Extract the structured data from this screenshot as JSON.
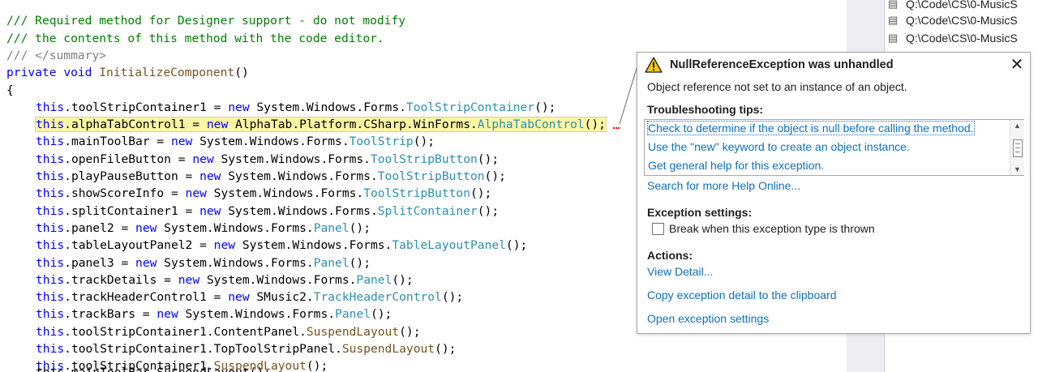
{
  "editor": {
    "lines": [
      [
        {
          "t": "/// ",
          "c": "comment"
        },
        {
          "t": "Required method for Designer support - do not modify",
          "c": "comment"
        }
      ],
      [
        {
          "t": "/// ",
          "c": "comment"
        },
        {
          "t": "the contents of this method with the code editor.",
          "c": "comment"
        }
      ],
      [
        {
          "t": "/// ",
          "c": "doctag"
        },
        {
          "t": "</summary>",
          "c": "doctag"
        }
      ],
      [
        {
          "t": "private",
          "c": "kw"
        },
        {
          "t": " ",
          "c": ""
        },
        {
          "t": "void",
          "c": "kw"
        },
        {
          "t": " ",
          "c": ""
        },
        {
          "t": "InitializeComponent",
          "c": "method"
        },
        {
          "t": "()",
          "c": ""
        }
      ],
      [
        {
          "t": "{",
          "c": ""
        }
      ],
      [
        {
          "t": "this",
          "c": "kw"
        },
        {
          "t": ".toolStripContainer1 = ",
          "c": ""
        },
        {
          "t": "new",
          "c": "kw"
        },
        {
          "t": " System.Windows.Forms.",
          "c": ""
        },
        {
          "t": "ToolStripContainer",
          "c": "type"
        },
        {
          "t": "();",
          "c": ""
        }
      ],
      [
        {
          "t": "this",
          "c": "kw"
        },
        {
          "t": ".alphaTabControl1 = ",
          "c": ""
        },
        {
          "t": "new",
          "c": "kw"
        },
        {
          "t": " AlphaTab.Platform.CSharp.WinForms.",
          "c": ""
        },
        {
          "t": "AlphaTabControl",
          "c": "type"
        },
        {
          "t": "();",
          "c": ""
        }
      ],
      [
        {
          "t": "this",
          "c": "kw"
        },
        {
          "t": ".mainToolBar = ",
          "c": ""
        },
        {
          "t": "new",
          "c": "kw"
        },
        {
          "t": " System.Windows.Forms.",
          "c": ""
        },
        {
          "t": "ToolStrip",
          "c": "type"
        },
        {
          "t": "();",
          "c": ""
        }
      ],
      [
        {
          "t": "this",
          "c": "kw"
        },
        {
          "t": ".openFileButton = ",
          "c": ""
        },
        {
          "t": "new",
          "c": "kw"
        },
        {
          "t": " System.Windows.Forms.",
          "c": ""
        },
        {
          "t": "ToolStripButton",
          "c": "type"
        },
        {
          "t": "();",
          "c": ""
        }
      ],
      [
        {
          "t": "this",
          "c": "kw"
        },
        {
          "t": ".playPauseButton = ",
          "c": ""
        },
        {
          "t": "new",
          "c": "kw"
        },
        {
          "t": " System.Windows.Forms.",
          "c": ""
        },
        {
          "t": "ToolStripButton",
          "c": "type"
        },
        {
          "t": "();",
          "c": ""
        }
      ],
      [
        {
          "t": "this",
          "c": "kw"
        },
        {
          "t": ".showScoreInfo = ",
          "c": ""
        },
        {
          "t": "new",
          "c": "kw"
        },
        {
          "t": " System.Windows.Forms.",
          "c": ""
        },
        {
          "t": "ToolStripButton",
          "c": "type"
        },
        {
          "t": "();",
          "c": ""
        }
      ],
      [
        {
          "t": "this",
          "c": "kw"
        },
        {
          "t": ".splitContainer1 = ",
          "c": ""
        },
        {
          "t": "new",
          "c": "kw"
        },
        {
          "t": " System.Windows.Forms.",
          "c": ""
        },
        {
          "t": "SplitContainer",
          "c": "type"
        },
        {
          "t": "();",
          "c": ""
        }
      ],
      [
        {
          "t": "this",
          "c": "kw"
        },
        {
          "t": ".panel2 = ",
          "c": ""
        },
        {
          "t": "new",
          "c": "kw"
        },
        {
          "t": " System.Windows.Forms.",
          "c": ""
        },
        {
          "t": "Panel",
          "c": "type"
        },
        {
          "t": "();",
          "c": ""
        }
      ],
      [
        {
          "t": "this",
          "c": "kw"
        },
        {
          "t": ".tableLayoutPanel2 = ",
          "c": ""
        },
        {
          "t": "new",
          "c": "kw"
        },
        {
          "t": " System.Windows.Forms.",
          "c": ""
        },
        {
          "t": "TableLayoutPanel",
          "c": "type"
        },
        {
          "t": "();",
          "c": ""
        }
      ],
      [
        {
          "t": "this",
          "c": "kw"
        },
        {
          "t": ".panel3 = ",
          "c": ""
        },
        {
          "t": "new",
          "c": "kw"
        },
        {
          "t": " System.Windows.Forms.",
          "c": ""
        },
        {
          "t": "Panel",
          "c": "type"
        },
        {
          "t": "();",
          "c": ""
        }
      ],
      [
        {
          "t": "this",
          "c": "kw"
        },
        {
          "t": ".trackDetails = ",
          "c": ""
        },
        {
          "t": "new",
          "c": "kw"
        },
        {
          "t": " System.Windows.Forms.",
          "c": ""
        },
        {
          "t": "Panel",
          "c": "type"
        },
        {
          "t": "();",
          "c": ""
        }
      ],
      [
        {
          "t": "this",
          "c": "kw"
        },
        {
          "t": ".trackHeaderControl1 = ",
          "c": ""
        },
        {
          "t": "new",
          "c": "kw"
        },
        {
          "t": " SMusic2.",
          "c": ""
        },
        {
          "t": "TrackHeaderControl",
          "c": "type"
        },
        {
          "t": "();",
          "c": ""
        }
      ],
      [
        {
          "t": "this",
          "c": "kw"
        },
        {
          "t": ".trackBars = ",
          "c": ""
        },
        {
          "t": "new",
          "c": "kw"
        },
        {
          "t": " System.Windows.Forms.",
          "c": ""
        },
        {
          "t": "Panel",
          "c": "type"
        },
        {
          "t": "();",
          "c": ""
        }
      ],
      [
        {
          "t": "this",
          "c": "kw"
        },
        {
          "t": ".toolStripContainer1.ContentPanel.",
          "c": ""
        },
        {
          "t": "SuspendLayout",
          "c": "method"
        },
        {
          "t": "();",
          "c": ""
        }
      ],
      [
        {
          "t": "this",
          "c": "kw"
        },
        {
          "t": ".toolStripContainer1.TopToolStripPanel.",
          "c": ""
        },
        {
          "t": "SuspendLayout",
          "c": "method"
        },
        {
          "t": "();",
          "c": ""
        }
      ],
      [
        {
          "t": "this",
          "c": "kw"
        },
        {
          "t": ".toolStripContainer1.",
          "c": ""
        },
        {
          "t": "SuspendLayout",
          "c": "method"
        },
        {
          "t": "();",
          "c": ""
        }
      ]
    ],
    "cutoff_line": "this.mainToolBar.SuspendLayout();"
  },
  "side_panel": {
    "items": [
      "Q:\\Code\\CS\\0-MusicS",
      "Q:\\Code\\CS\\0-MusicS",
      "Q:\\Code\\CS\\0-MusicS"
    ]
  },
  "exception": {
    "title": "NullReferenceException was unhandled",
    "message": "Object reference not set to an instance of an object.",
    "tips_heading": "Troubleshooting tips:",
    "tips": [
      "Check to determine if the object is null before calling the method.",
      "Use the \"new\" keyword to create an object instance.",
      "Get general help for this exception."
    ],
    "search_link": "Search for more Help Online...",
    "settings_heading": "Exception settings:",
    "break_checkbox_label": "Break when this exception type is thrown",
    "break_checked": false,
    "actions_heading": "Actions:",
    "actions": [
      "View Detail...",
      "Copy exception detail to the clipboard",
      "Open exception settings"
    ],
    "close_glyph": "✕"
  },
  "colors": {
    "comment": "#008000",
    "keyword": "#0000ff",
    "type": "#2b91af",
    "highlight": "#fbf5a6",
    "link": "#0e70c0",
    "warning": "#f2c811"
  }
}
